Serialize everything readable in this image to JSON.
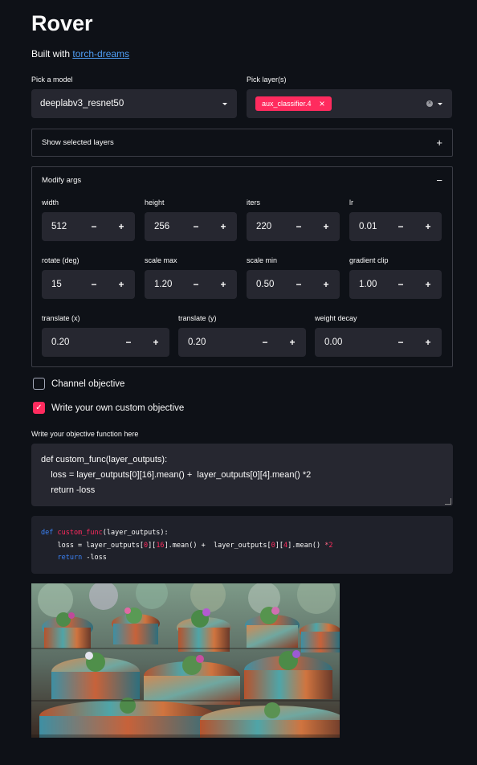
{
  "header": {
    "title": "Rover",
    "subtitle_prefix": "Built with ",
    "subtitle_link": "torch-dreams"
  },
  "model_select": {
    "label": "Pick a model",
    "value": "deeplabv3_resnet50"
  },
  "layer_select": {
    "label": "Pick layer(s)",
    "tags": [
      "aux_classifier.4"
    ]
  },
  "show_layers_expander": {
    "label": "Show selected layers",
    "sign": "+"
  },
  "modify_args": {
    "label": "Modify args",
    "sign": "−",
    "row1": [
      {
        "label": "width",
        "value": "512"
      },
      {
        "label": "height",
        "value": "256"
      },
      {
        "label": "iters",
        "value": "220"
      },
      {
        "label": "lr",
        "value": "0.01"
      }
    ],
    "row2": [
      {
        "label": "rotate (deg)",
        "value": "15"
      },
      {
        "label": "scale max",
        "value": "1.20"
      },
      {
        "label": "scale min",
        "value": "0.50"
      },
      {
        "label": "gradient clip",
        "value": "1.00"
      }
    ],
    "row3": [
      {
        "label": "translate (x)",
        "value": "0.20"
      },
      {
        "label": "translate (y)",
        "value": "0.20"
      },
      {
        "label": "weight decay",
        "value": "0.00"
      }
    ],
    "minus": "−",
    "plus": "+"
  },
  "checkboxes": {
    "channel_objective": {
      "label": "Channel objective",
      "checked": false
    },
    "custom_objective": {
      "label": "Write your own custom objective",
      "checked": true
    }
  },
  "objective_editor": {
    "label": "Write your objective function here",
    "lines": [
      "def custom_func(layer_outputs):",
      "    loss = layer_outputs[0][16].mean() +  layer_outputs[0][4].mean() *2",
      "    return -loss"
    ]
  },
  "code_preview": {
    "line1": {
      "kw": "def",
      "fn": "custom_func",
      "rest": "(layer_outputs):"
    },
    "line2": {
      "a": "    loss = layer_outputs[",
      "n1": "0",
      "b": "][",
      "n2": "16",
      "c": "].mean() + ",
      "d": " layer_outputs[",
      "n3": "0",
      "e": "][",
      "n4": "4",
      "f": "].mean() ",
      "g": "*",
      "n5": "2"
    },
    "line3": {
      "indent": "    ",
      "kw": "return",
      "rest": " -loss"
    }
  },
  "colors": {
    "background": "#0e1117",
    "accent": "#ff2b5e",
    "widget_bg": "#262730",
    "link": "#4f9ef5"
  }
}
